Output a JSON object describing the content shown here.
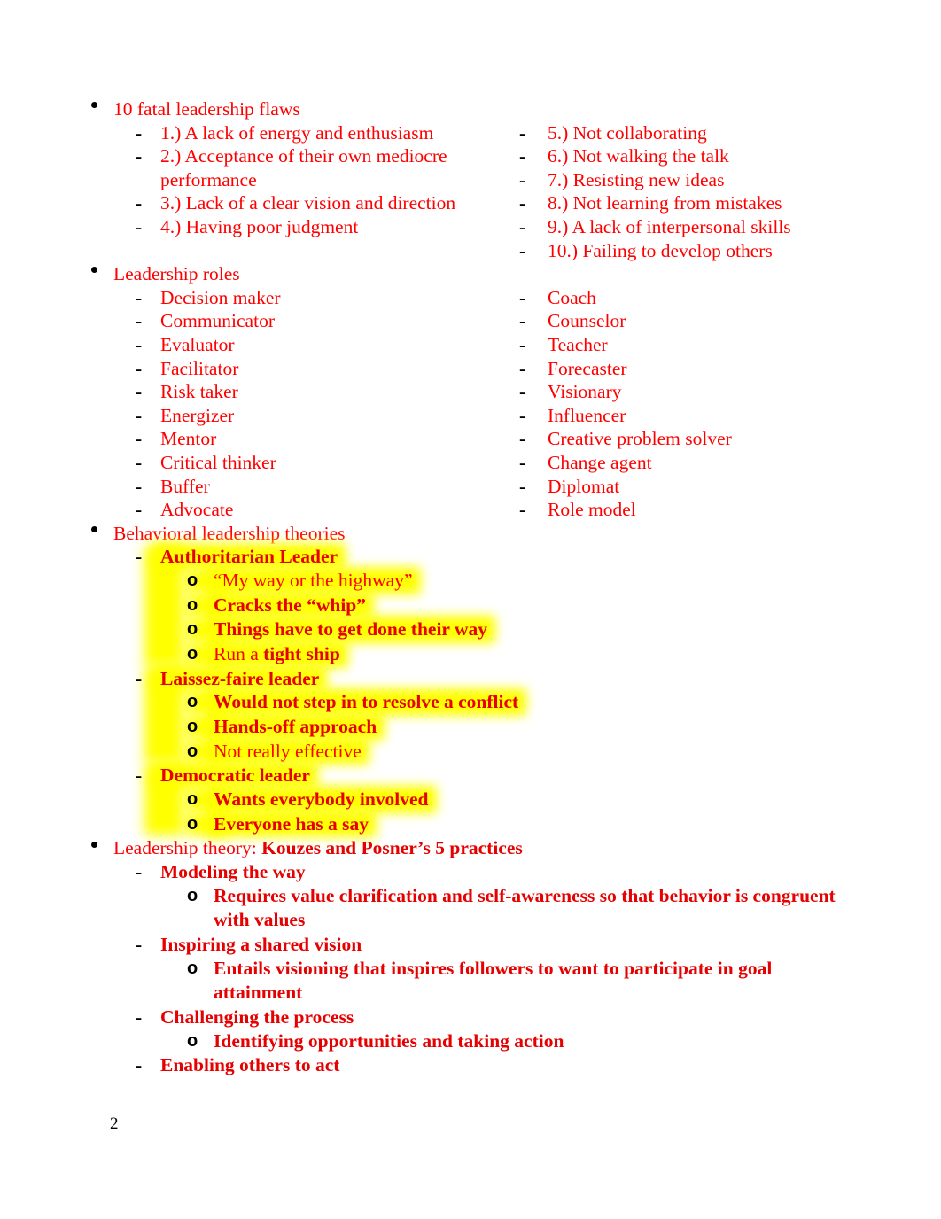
{
  "document": {
    "page_number": "2",
    "colors": {
      "text_red": "#ff0000",
      "bold_red": "#e60000",
      "highlight_yellow": "#ffff00",
      "marker_black": "#000000"
    },
    "markers": {
      "bullet": "•",
      "dash": "-",
      "circle": "o"
    }
  },
  "sections": [
    {
      "heading": "10 fatal leadership flaws",
      "left_items": [
        "1.) A lack of energy and enthusiasm",
        "2.) Acceptance of their own mediocre performance",
        "3.) Lack of a clear vision and direction",
        "4.) Having poor judgment"
      ],
      "right_items": [
        "5.) Not collaborating",
        "6.) Not walking the talk",
        "7.) Resisting new ideas",
        "8.) Not learning from mistakes",
        "9.) A lack of interpersonal skills",
        "10.) Failing to develop others"
      ]
    },
    {
      "heading": "Leadership roles",
      "left_items": [
        "Decision maker",
        "Communicator",
        "Evaluator",
        "Facilitator",
        "Risk taker",
        "Energizer",
        "Mentor",
        "Critical thinker",
        "Buffer",
        "Advocate"
      ],
      "right_items": [
        "Coach",
        "Counselor",
        "Teacher",
        "Forecaster",
        "Visionary",
        "Influencer",
        "Creative problem solver",
        "Change agent",
        "Diplomat",
        "Role model"
      ]
    }
  ],
  "behavioral": {
    "heading": "Behavioral leadership theories",
    "styles": [
      {
        "name": "Authoritarian Leader",
        "points": [
          {
            "text": "“My way or the highway”",
            "bold": false
          },
          {
            "text": "Cracks the “whip”",
            "bold": true
          },
          {
            "text": "Things have to get done their way",
            "bold": true
          },
          {
            "prefix": "Run a ",
            "text": "tight ship",
            "bold": "partial"
          }
        ]
      },
      {
        "name": "Laissez-faire leader",
        "points": [
          {
            "text": "Would not step in to resolve a conflict",
            "bold": true
          },
          {
            "text": "Hands-off approach",
            "bold": true
          },
          {
            "text": "Not really effective",
            "bold": false
          }
        ]
      },
      {
        "name": "Democratic leader",
        "points": [
          {
            "text": "Wants everybody involved",
            "bold": true
          },
          {
            "text": "Everyone has a say",
            "bold": true
          }
        ]
      }
    ]
  },
  "theory": {
    "heading_plain": "Leadership theory: ",
    "heading_bold": "Kouzes and Posner’s 5 practices",
    "practices": [
      {
        "name": "Modeling the way",
        "detail": "Requires value clarification and self-awareness so that behavior is congruent with values"
      },
      {
        "name": "Inspiring a shared vision",
        "detail": "Entails visioning that inspires followers to want to participate in goal attainment"
      },
      {
        "name": "Challenging the process",
        "detail": "Identifying opportunities and taking action"
      },
      {
        "name": "Enabling others to act",
        "detail": null
      }
    ]
  }
}
